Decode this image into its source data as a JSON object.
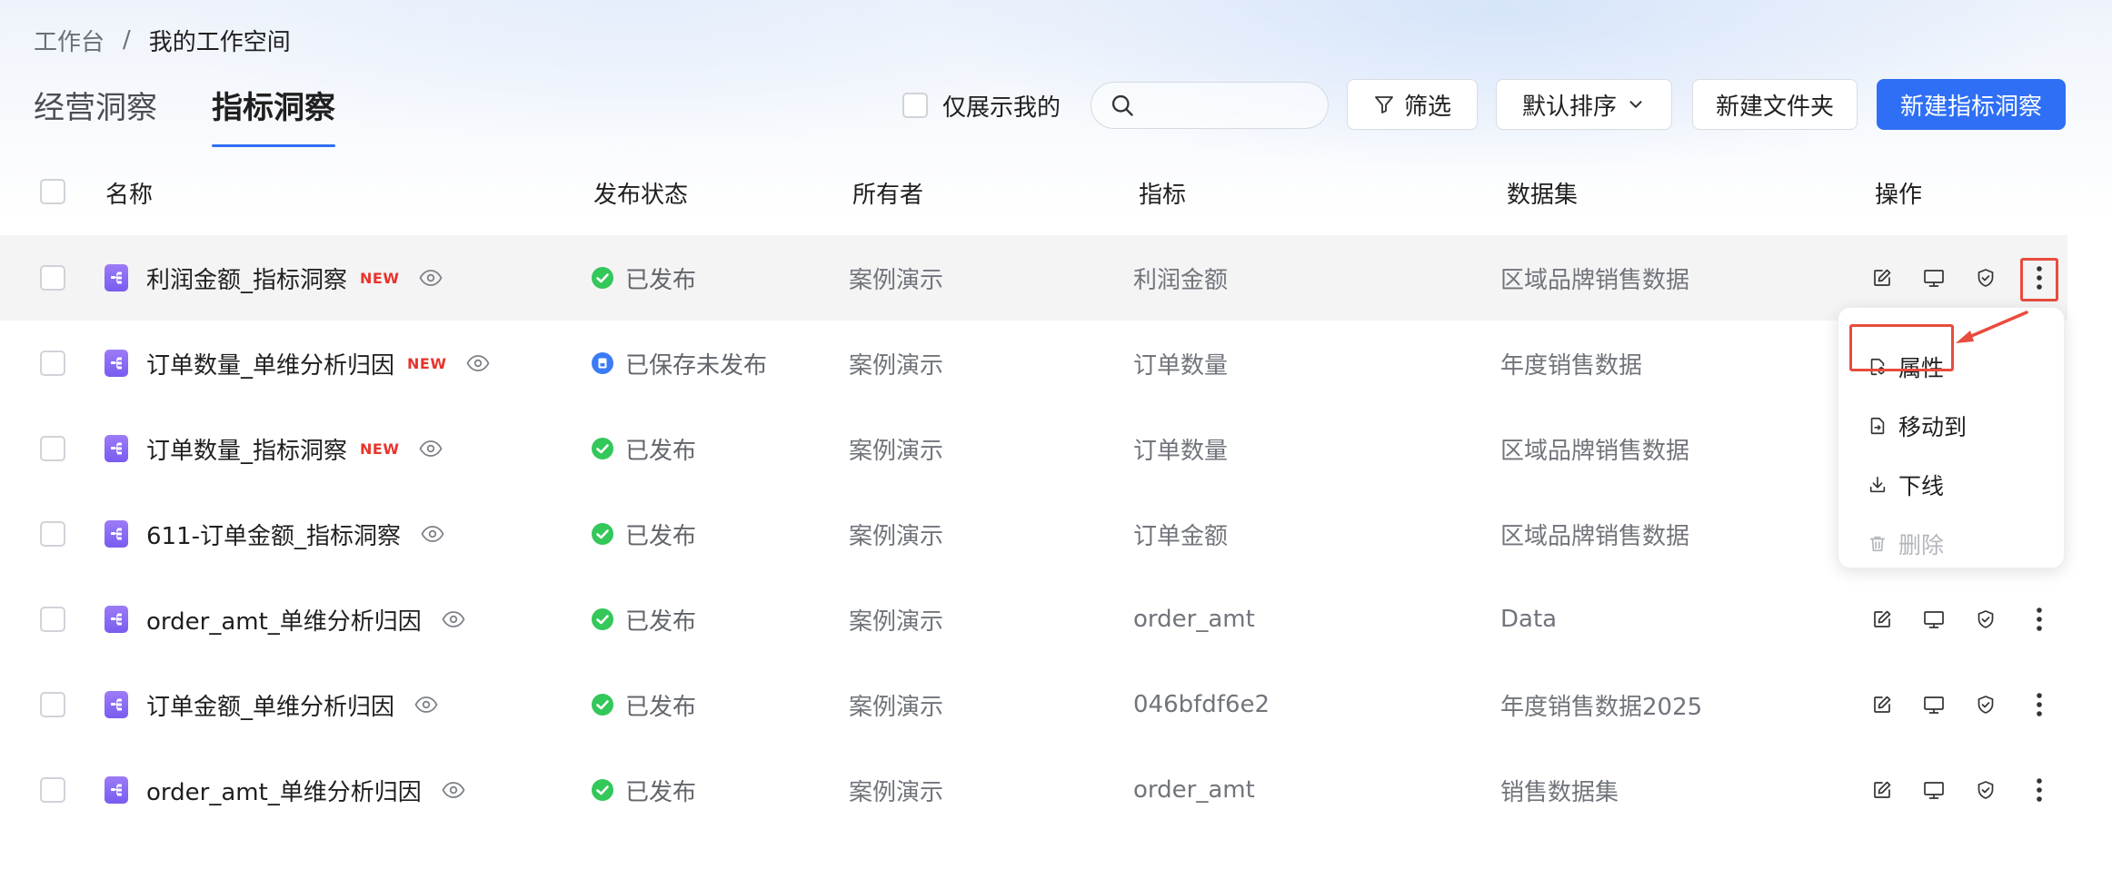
{
  "breadcrumb": {
    "workspace": "工作台",
    "separator": "/",
    "current": "我的工作空间"
  },
  "tabs": [
    {
      "label": "经营洞察",
      "active": false
    },
    {
      "label": "指标洞察",
      "active": true
    }
  ],
  "toolbar": {
    "only_mine_label": "仅展示我的",
    "only_mine_checked": false,
    "search_placeholder": "",
    "search_value": "",
    "filter_label": "筛选",
    "sort_label": "默认排序",
    "new_folder_label": "新建文件夹",
    "new_insight_label": "新建指标洞察"
  },
  "table": {
    "headers": {
      "name": "名称",
      "status": "发布状态",
      "owner": "所有者",
      "metric": "指标",
      "dataset": "数据集",
      "actions": "操作"
    },
    "rows": [
      {
        "name": "利润金额_指标洞察",
        "badge": "NEW",
        "status": "已发布",
        "status_type": "published",
        "owner": "案例演示",
        "metric": "利润金额",
        "dataset": "区域品牌销售数据"
      },
      {
        "name": "订单数量_单维分析归因",
        "badge": "NEW",
        "status": "已保存未发布",
        "status_type": "saved",
        "owner": "案例演示",
        "metric": "订单数量",
        "dataset": "年度销售数据"
      },
      {
        "name": "订单数量_指标洞察",
        "badge": "NEW",
        "status": "已发布",
        "status_type": "published",
        "owner": "案例演示",
        "metric": "订单数量",
        "dataset": "区域品牌销售数据"
      },
      {
        "name": "611-订单金额_指标洞察",
        "badge": "",
        "status": "已发布",
        "status_type": "published",
        "owner": "案例演示",
        "metric": "订单金额",
        "dataset": "区域品牌销售数据"
      },
      {
        "name": "order_amt_单维分析归因",
        "badge": "",
        "status": "已发布",
        "status_type": "published",
        "owner": "案例演示",
        "metric": "order_amt",
        "dataset": "Data"
      },
      {
        "name": "订单金额_单维分析归因",
        "badge": "",
        "status": "已发布",
        "status_type": "published",
        "owner": "案例演示",
        "metric": "046bfdf6e2",
        "dataset": "年度销售数据2025"
      },
      {
        "name": "order_amt_单维分析归因",
        "badge": "",
        "status": "已发布",
        "status_type": "published",
        "owner": "案例演示",
        "metric": "order_amt",
        "dataset": "销售数据集"
      }
    ]
  },
  "more_menu": {
    "items": [
      {
        "label": "属性",
        "icon": "properties-icon",
        "disabled": false
      },
      {
        "label": "移动到",
        "icon": "move-icon",
        "disabled": false
      },
      {
        "label": "下线",
        "icon": "offline-icon",
        "disabled": false
      },
      {
        "label": "删除",
        "icon": "delete-icon",
        "disabled": true
      }
    ]
  },
  "colors": {
    "primary": "#2f6ff5",
    "published": "#34c759",
    "saved": "#3b7cf6",
    "new_badge": "#e8342c",
    "highlight": "#e84c3d",
    "doc_icon": "#8b6cf4"
  }
}
